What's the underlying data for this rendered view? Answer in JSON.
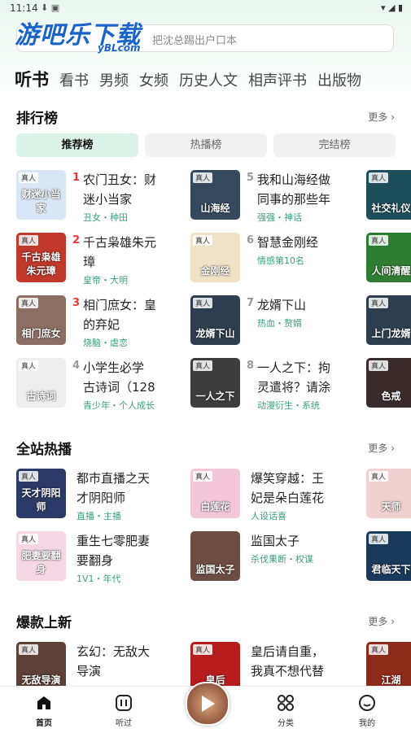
{
  "status": {
    "time": "11:14"
  },
  "header": {
    "logo": "游吧乐下载",
    "logo_sub": "yBLcom",
    "search_placeholder": "把沈总踢出户口本"
  },
  "tabs": [
    "听书",
    "看书",
    "男频",
    "女频",
    "历史人文",
    "相声评书",
    "出版物"
  ],
  "sections": {
    "ranking": {
      "title": "排行榜",
      "more": "更多",
      "subtabs": [
        "推荐榜",
        "热播榜",
        "完结榜"
      ],
      "items": [
        {
          "rank": "1",
          "title1": "农门丑女：财",
          "title2": "迷小当家",
          "tags": "丑女・种田",
          "cover_tag": "真人",
          "cover_text": "财迷小当家",
          "color": "#d9e6f5"
        },
        {
          "rank": "2",
          "title1": "千古枭雄朱元",
          "title2": "璋",
          "tags": "皇帝・大明",
          "cover_tag": "真人",
          "cover_text": "千古枭雄朱元璋",
          "color": "#c0392b"
        },
        {
          "rank": "3",
          "title1": "相门庶女：皇",
          "title2": "的弃妃",
          "tags": "烧脑・虐恋",
          "cover_tag": "真人",
          "cover_text": "相门庶女",
          "color": "#8d6e63"
        },
        {
          "rank": "4",
          "title1": "小学生必学",
          "title2": "古诗词（128",
          "tags": "青少年・个人成长",
          "cover_tag": "真人",
          "cover_text": "古诗词",
          "color": "#eeeeee"
        },
        {
          "rank": "5",
          "title1": "我和山海经做",
          "title2": "同事的那些年",
          "tags": "强强・神话",
          "cover_tag": "真人",
          "cover_text": "山海经",
          "color": "#34495e"
        },
        {
          "rank": "6",
          "title1": "智慧金刚经",
          "title2": "",
          "tags": "情感第10名",
          "cover_tag": "真人",
          "cover_text": "金刚经",
          "color": "#f0e2c6"
        },
        {
          "rank": "7",
          "title1": "龙婿下山",
          "title2": "",
          "tags": "热血・赘婿",
          "cover_tag": "真人",
          "cover_text": "龙婿下山",
          "color": "#2c3e50"
        },
        {
          "rank": "8",
          "title1": "一人之下：拘",
          "title2": "灵遣将？请涂",
          "tags": "动漫衍生・系统",
          "cover_tag": "真人",
          "cover_text": "一人之下",
          "color": "#3d3d3d"
        }
      ],
      "peek": [
        {
          "cover_tag": "真人",
          "cover_text": "社交礼仪",
          "color": "#1e4d5c"
        },
        {
          "cover_tag": "真人",
          "cover_text": "人间清醒",
          "color": "#2e7d32"
        },
        {
          "cover_tag": "真人",
          "cover_text": "上门龙婿",
          "color": "#2c3e50"
        },
        {
          "cover_tag": "真人",
          "cover_text": "色戒",
          "color": "#3a2b2b"
        }
      ]
    },
    "hot": {
      "title": "全站热播",
      "more": "更多",
      "items": [
        {
          "title1": "都市直播之天",
          "title2": "才阴阳师",
          "tags": "直播・主播",
          "cover_tag": "真人",
          "cover_text": "天才阴阳师",
          "color": "#2b3a67"
        },
        {
          "title1": "重生七零肥妻",
          "title2": "要翻身",
          "tags": "1V1・年代",
          "cover_tag": "真人",
          "cover_text": "肥妻要翻身",
          "color": "#f6d7e4"
        },
        {
          "title1": "爆笑穿越：王",
          "title2": "妃是朵白莲花",
          "tags": "人设话喜",
          "cover_tag": "真人",
          "cover_text": "白莲花",
          "color": "#f3c6d8"
        },
        {
          "title1": "监国太子",
          "title2": "",
          "tags": "杀伐果断・权谋",
          "cover_tag": "",
          "cover_text": "监国太子",
          "color": "#6d4c41"
        }
      ],
      "peek": [
        {
          "cover_tag": "真人",
          "cover_text": "天师",
          "color": "#f0d0d0"
        },
        {
          "cover_tag": "真人",
          "cover_text": "君临天下",
          "color": "#1a3a5c"
        }
      ]
    },
    "new": {
      "title": "爆款上新",
      "more": "更多",
      "items": [
        {
          "title1": "玄幻：无敌大",
          "title2": "导演",
          "tags": "",
          "cover_tag": "真人",
          "cover_text": "无敌导演",
          "color": "#5d4037"
        },
        {
          "title1": "皇后请自重，",
          "title2": "我真不想代替",
          "tags": "",
          "cover_tag": "真人",
          "cover_text": "皇后",
          "color": "#b71c1c"
        }
      ],
      "peek": [
        {
          "cover_tag": "真人",
          "cover_text": "江湖",
          "color": "#8d2b1a"
        }
      ]
    }
  },
  "bottomnav": [
    "首页",
    "听过",
    "分类",
    "我的"
  ]
}
